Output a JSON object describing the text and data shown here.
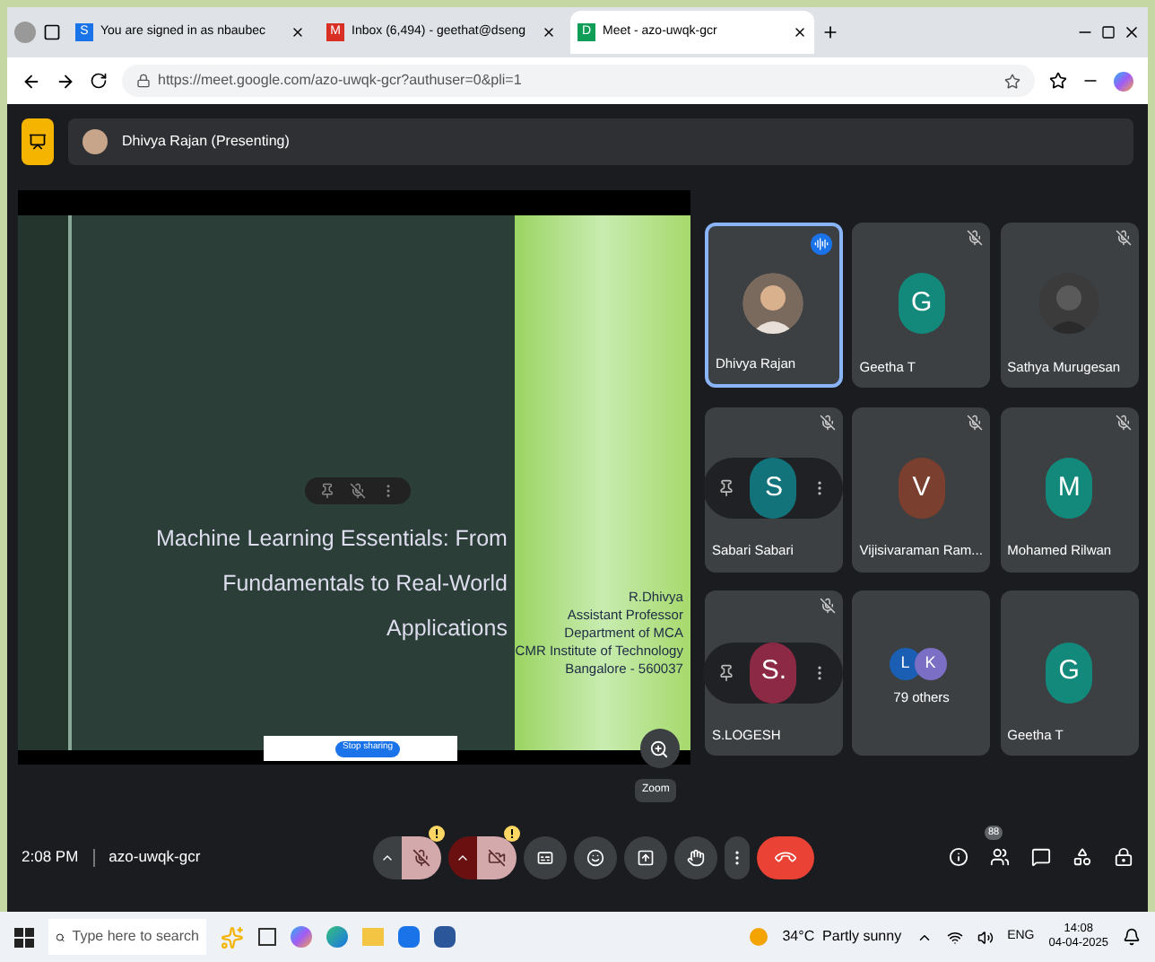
{
  "browser": {
    "tabs": [
      {
        "title": "You are signed in as nbaubec",
        "icon": "S",
        "selected": false
      },
      {
        "title": "Inbox (6,494) - geethat@dseng",
        "icon": "M",
        "selected": false
      },
      {
        "title": "Meet - azo-uwqk-gcr",
        "icon": "D",
        "selected": true
      }
    ],
    "url": "https://meet.google.com/azo-uwqk-gcr?authuser=0&pli=1"
  },
  "presenter_bar": {
    "label": "Dhivya Rajan (Presenting)"
  },
  "slide": {
    "title": "Machine Learning Essentials: From Fundamentals to Real-World Applications",
    "author_lines": [
      "R.Dhivya",
      "Assistant Professor",
      "Department of MCA",
      "CMR Institute of Technology",
      "Bangalore - 560037"
    ],
    "share_button": "Stop sharing"
  },
  "zoom_tooltip": "Zoom",
  "participants": [
    {
      "name": "Dhivya Rajan",
      "selected": true,
      "speaking": true,
      "muted": false
    },
    {
      "name": "Geetha T",
      "kind": "letter",
      "letter": "G",
      "color": "#13897b",
      "selected": false,
      "speaking": false,
      "muted": true
    },
    {
      "name": "Sathya Murugesan",
      "selected": false,
      "speaking": false,
      "muted": true
    },
    {
      "name": "Sabari Sabari",
      "kind": "pinned",
      "letter": "S",
      "color": "#12747a",
      "selected": false,
      "speaking": false,
      "muted": true
    },
    {
      "name": "Vijisivaraman Ram...",
      "kind": "letter",
      "letter": "V",
      "color": "#7b3f2f",
      "selected": false,
      "speaking": false,
      "muted": true
    },
    {
      "name": "Mohamed Rilwan",
      "kind": "letter",
      "letter": "M",
      "color": "#13897b",
      "selected": false,
      "speaking": false,
      "muted": true
    },
    {
      "name": "S.LOGESH",
      "kind": "pinned",
      "letter": "S.",
      "color": "#8c2a45",
      "selected": false,
      "speaking": false,
      "muted": true
    },
    {
      "name": "79 others",
      "kind": "others",
      "letters": [
        {
          "letter": "L",
          "color": "#1a5fb4"
        },
        {
          "letter": "K",
          "color": "#7a6fc4"
        }
      ],
      "selected": false,
      "speaking": false,
      "muted": false
    },
    {
      "name": "Geetha T",
      "kind": "letter",
      "letter": "G",
      "color": "#13897b",
      "selected": false,
      "speaking": false,
      "muted": false
    }
  ],
  "meeting": {
    "time": "2:08 PM",
    "code": "azo-uwqk-gcr",
    "people_count": "88"
  },
  "controls": [
    {
      "kind": "mic",
      "off": true
    },
    {
      "kind": "camera",
      "off": true
    },
    {
      "kind": "captions"
    },
    {
      "kind": "emoji"
    },
    {
      "kind": "present"
    },
    {
      "kind": "hand"
    },
    {
      "kind": "more"
    },
    {
      "kind": "leave"
    }
  ],
  "taskbar": {
    "search_placeholder": "Type here to search",
    "weather": "34°C  Partly sunny",
    "language": "ENG",
    "time": "14:08",
    "date": "04-04-2025"
  }
}
